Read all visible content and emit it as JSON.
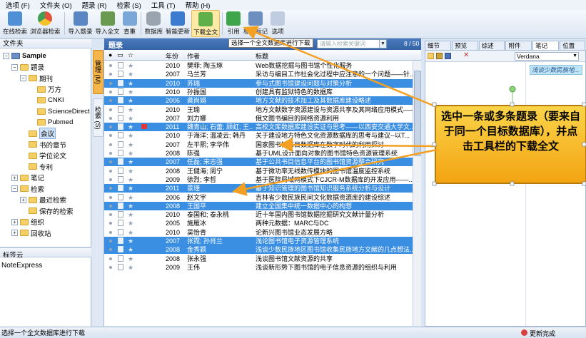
{
  "menu": [
    "选项 (F)",
    "文件夹 (O)",
    "题录 (R)",
    "检索 (S)",
    "工具 (T)",
    "帮助 (H)"
  ],
  "toolbar": [
    {
      "label": "在线检索",
      "icon": "globe-search-icon"
    },
    {
      "label": "浏览器检索",
      "icon": "chrome-icon"
    },
    {
      "label": "导入题录",
      "icon": "import-icon"
    },
    {
      "label": "导入全文",
      "icon": "import-fulltext-icon"
    },
    {
      "label": "查重",
      "icon": "duplicate-icon"
    },
    {
      "label": "数据库",
      "icon": "database-icon"
    },
    {
      "label": "智能更新",
      "icon": "smart-update-icon"
    },
    {
      "label": "下载全文",
      "icon": "download-fulltext-icon"
    },
    {
      "label": "引用",
      "icon": "cite-icon"
    },
    {
      "label": "标签标记",
      "icon": "tag-icon"
    },
    {
      "label": "选项",
      "icon": "options-icon"
    }
  ],
  "tooltip": "选择一个全文数据库进行下载",
  "search_placeholder": "请输入检索关键词",
  "left_panel_title": "文件夹",
  "tree": [
    {
      "label": "Sample",
      "depth": 0,
      "exp": "−",
      "bold": true
    },
    {
      "label": "题录",
      "depth": 1,
      "exp": "−"
    },
    {
      "label": "期刊",
      "depth": 2,
      "exp": "−"
    },
    {
      "label": "万方",
      "depth": 3
    },
    {
      "label": "CNKI",
      "depth": 3
    },
    {
      "label": "ScienceDirect",
      "depth": 3
    },
    {
      "label": "Pubmed",
      "depth": 3
    },
    {
      "label": "会议",
      "depth": 2,
      "sel": true
    },
    {
      "label": "书的章节",
      "depth": 2
    },
    {
      "label": "学位论文",
      "depth": 2
    },
    {
      "label": "专利",
      "depth": 2
    },
    {
      "label": "笔记",
      "depth": 1,
      "exp": "+"
    },
    {
      "label": "检索",
      "depth": 1,
      "exp": "−"
    },
    {
      "label": "最近检索",
      "depth": 2,
      "exp": "+"
    },
    {
      "label": "保存的检索",
      "depth": 2
    },
    {
      "label": "组织",
      "depth": 1,
      "exp": "+"
    },
    {
      "label": "回收站",
      "depth": 1,
      "exp": "+"
    }
  ],
  "tagcloud": {
    "title": "标签云",
    "value": "NoteExpress"
  },
  "vtabs": [
    "管理 (M)",
    "检索 (S)"
  ],
  "grid_title": "题录",
  "pager": "8 / 50",
  "columns": {
    "year": "年份",
    "author": "作者",
    "title": "标题"
  },
  "rows": [
    {
      "year": "2010",
      "author": "樊菲; 陶玉琢",
      "title": "Web数据挖掘与图书馆个性化服务",
      "sel": false
    },
    {
      "year": "2007",
      "author": "马兰芳",
      "title": "采访与编目工作社会化过程中应注意的一个问题——针...",
      "sel": false
    },
    {
      "year": "2010",
      "author": "苏瑞",
      "title": "参与式图书馆建设问题与对策分析",
      "sel": true
    },
    {
      "year": "2010",
      "author": "孙振国",
      "title": "创建具有监狱特色的数据库",
      "sel": false
    },
    {
      "year": "2006",
      "author": "龚尚娟",
      "title": "地方文献的技术加工及其数据库建设略述",
      "sel": true
    },
    {
      "year": "2010",
      "author": "王瑜",
      "title": "地方文献数字资源建设与资源共享及其网络应用模式——以北京地...",
      "sel": false
    },
    {
      "year": "2007",
      "author": "刘力娜",
      "title": "俄文图书编目的网络资源利用",
      "sel": false
    },
    {
      "year": "2011",
      "author": "魏青山; 石蕾; 顾虹; 王...",
      "title": "高校文库数据库建设实证与思考——以西安交通大学文...",
      "sel": true,
      "flag": true
    },
    {
      "year": "2010",
      "author": "于海洋; 温凌云; 韩丹",
      "title": "关于建设地方特色文化资源数据库的思考与建议--以T...",
      "sel": false
    },
    {
      "year": "2007",
      "author": "左平熙; 李华伟",
      "title": "国家图书馆书目数据库在数字时代的利用探讨",
      "sel": false
    },
    {
      "year": "2008",
      "author": "陈强",
      "title": "基于UML设计面向对象的图书馆特色资源管理系统",
      "sel": false
    },
    {
      "year": "2007",
      "author": "任磊; 宋志强",
      "title": "基于公共书目信息平台的图书馆资源整合研究",
      "sel": true
    },
    {
      "year": "2008",
      "author": "王健海; 周宁",
      "title": "基于微功率无线数传模块的图书馆温度监控系统",
      "sel": false
    },
    {
      "year": "2009",
      "author": "徐烈; 李哲",
      "title": "基于医院局域网模式下CJCR-M数据库的开发应用——...",
      "sel": false
    },
    {
      "year": "2011",
      "author": "景瑾",
      "title": "基于知识管理的图书馆知识服务系统分析与设计",
      "sel": true
    },
    {
      "year": "2006",
      "author": "赵文宇",
      "title": "吉林省少数民族民间文化数据资源库的建设综述",
      "sel": false
    },
    {
      "year": "2008",
      "author": "王国平",
      "title": "建立全国集中统一数据中心的构想",
      "sel": true
    },
    {
      "year": "2010",
      "author": "泰国和; 泰永桃",
      "title": "近十年国内图书馆数据挖掘研究文献计量分析",
      "sel": false
    },
    {
      "year": "2005",
      "author": "施雁冰",
      "title": "两种元数据：MARC与DC",
      "sel": false
    },
    {
      "year": "2010",
      "author": "吴怡青",
      "title": "论新兴图书馆业态发展方略",
      "sel": false
    },
    {
      "year": "2007",
      "author": "张霓; 孙肖兰",
      "title": "浅论图书馆电子资源管理系统",
      "sel": true
    },
    {
      "year": "2008",
      "author": "金秀颖",
      "title": "浅谈少数民族地区图书馆收集民族地方文献的几点想法...",
      "sel": true
    },
    {
      "year": "2008",
      "author": "张永强",
      "title": "浅谈图书馆文献资源的共享",
      "sel": false
    },
    {
      "year": "2009",
      "author": "王伟",
      "title": "浅谈新形势下图书馆的电子信息资源的组织与利用",
      "sel": false
    }
  ],
  "right_tabs": [
    "细节 (D)",
    "预览 (P)",
    "综述 (S)",
    "附件 (K)",
    "笔记 (N)",
    "位置 (L)"
  ],
  "editor_font": "Verdana",
  "note_link": "浅谈少数民族地...",
  "callout": "选中一条或多条题录（要来自于同一个目标数据库），并点击工具栏的下载全文",
  "status_text": "选择一个全文数据库进行下载",
  "status_right": "更新完成",
  "colors": {
    "selected_row": "#3b8fe3",
    "header_blue": "#3664a5",
    "callout": "#f6b624",
    "arrow": "#f4a022"
  }
}
